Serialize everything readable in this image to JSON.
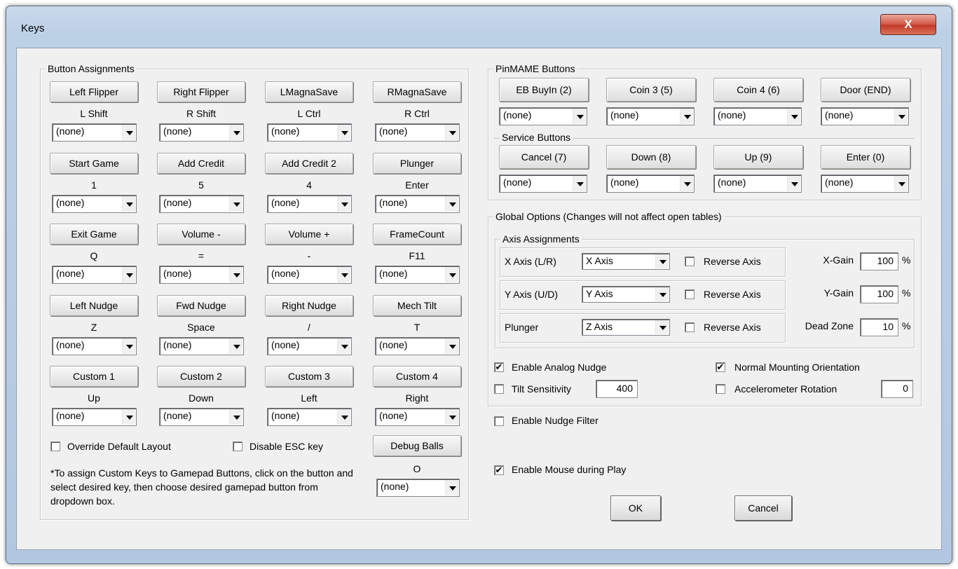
{
  "window": {
    "title": "Keys",
    "close_glyph": "X"
  },
  "button_assignments": {
    "title": "Button Assignments",
    "cells": [
      {
        "label": "Left Flipper",
        "key": "L Shift",
        "value": "(none)"
      },
      {
        "label": "Right Flipper",
        "key": "R Shift",
        "value": "(none)"
      },
      {
        "label": "LMagnaSave",
        "key": "L Ctrl",
        "value": "(none)"
      },
      {
        "label": "RMagnaSave",
        "key": "R Ctrl",
        "value": "(none)"
      },
      {
        "label": "Start Game",
        "key": "1",
        "value": "(none)"
      },
      {
        "label": "Add Credit",
        "key": "5",
        "value": "(none)"
      },
      {
        "label": "Add Credit 2",
        "key": "4",
        "value": "(none)"
      },
      {
        "label": "Plunger",
        "key": "Enter",
        "value": "(none)"
      },
      {
        "label": "Exit Game",
        "key": "Q",
        "value": "(none)"
      },
      {
        "label": "Volume -",
        "key": "=",
        "value": "(none)"
      },
      {
        "label": "Volume +",
        "key": "-",
        "value": "(none)"
      },
      {
        "label": "FrameCount",
        "key": "F11",
        "value": "(none)"
      },
      {
        "label": "Left Nudge",
        "key": "Z",
        "value": "(none)"
      },
      {
        "label": "Fwd Nudge",
        "key": "Space",
        "value": "(none)"
      },
      {
        "label": "Right Nudge",
        "key": "/",
        "value": "(none)"
      },
      {
        "label": "Mech Tilt",
        "key": "T",
        "value": "(none)"
      },
      {
        "label": "Custom 1",
        "key": "Up",
        "value": "(none)"
      },
      {
        "label": "Custom 2",
        "key": "Down",
        "value": "(none)"
      },
      {
        "label": "Custom 3",
        "key": "Left",
        "value": "(none)"
      },
      {
        "label": "Custom 4",
        "key": "Right",
        "value": "(none)"
      }
    ],
    "override_default_layout": {
      "label": "Override Default Layout",
      "checked": false
    },
    "disable_esc": {
      "label": "Disable ESC key",
      "checked": false
    },
    "debug_balls": {
      "label": "Debug Balls",
      "key": "O",
      "value": "(none)"
    },
    "note": "*To assign Custom Keys to Gamepad Buttons, click on the button and select desired key, then choose desired gamepad button from dropdown box."
  },
  "pinmame": {
    "title": "PinMAME Buttons",
    "buttons": [
      {
        "label": "EB BuyIn (2)",
        "value": "(none)"
      },
      {
        "label": "Coin 3 (5)",
        "value": "(none)"
      },
      {
        "label": "Coin 4 (6)",
        "value": "(none)"
      },
      {
        "label": "Door (END)",
        "value": "(none)"
      }
    ],
    "service_title": "Service Buttons",
    "service": [
      {
        "label": "Cancel (7)",
        "value": "(none)"
      },
      {
        "label": "Down (8)",
        "value": "(none)"
      },
      {
        "label": "Up (9)",
        "value": "(none)"
      },
      {
        "label": "Enter (0)",
        "value": "(none)"
      }
    ]
  },
  "global_options": {
    "title": "Global Options (Changes will not affect open tables)",
    "axis_title": "Axis Assignments",
    "axes": [
      {
        "label": "X Axis (L/R)",
        "value": "X Axis",
        "reverse": "Reverse Axis",
        "reverse_checked": false,
        "gain_label": "X-Gain",
        "gain": "100",
        "unit": "%"
      },
      {
        "label": "Y Axis (U/D)",
        "value": "Y Axis",
        "reverse": "Reverse Axis",
        "reverse_checked": false,
        "gain_label": "Y-Gain",
        "gain": "100",
        "unit": "%"
      },
      {
        "label": "Plunger",
        "value": "Z Axis",
        "reverse": "Reverse Axis",
        "reverse_checked": false,
        "gain_label": "Dead Zone",
        "gain": "10",
        "unit": "%"
      }
    ],
    "enable_analog_nudge": {
      "label": "Enable Analog Nudge",
      "checked": true
    },
    "normal_mounting": {
      "label": "Normal Mounting Orientation",
      "checked": true
    },
    "tilt_sensitivity": {
      "label": "Tilt Sensitivity",
      "checked": false,
      "value": "400"
    },
    "accelerometer_rotation": {
      "label": "Accelerometer Rotation",
      "checked": false,
      "value": "0"
    }
  },
  "enable_nudge_filter": {
    "label": "Enable Nudge Filter",
    "checked": false
  },
  "enable_mouse": {
    "label": "Enable Mouse during Play",
    "checked": true
  },
  "ok_label": "OK",
  "cancel_label": "Cancel"
}
